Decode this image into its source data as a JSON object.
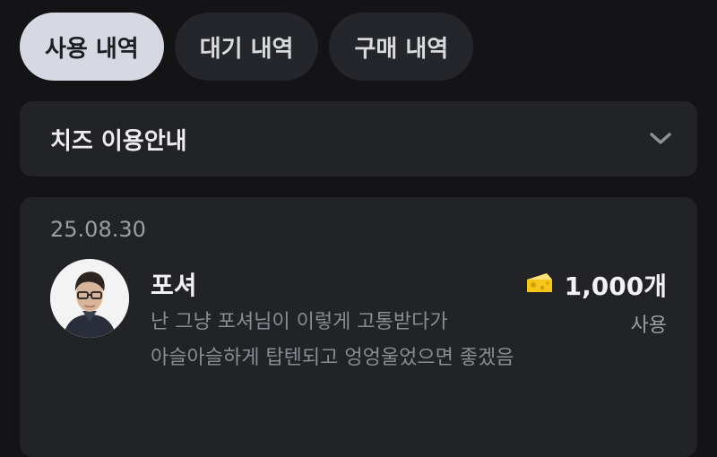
{
  "tabs": [
    {
      "label": "사용 내역",
      "active": true
    },
    {
      "label": "대기 내역",
      "active": false
    },
    {
      "label": "구매 내역",
      "active": false
    }
  ],
  "accordion": {
    "title": "치즈 이용안내",
    "icon": "chevron-down-icon"
  },
  "history": [
    {
      "date": "25.08.30",
      "name": "포셔",
      "message": "난 그냥 포셔님이 이렇게 고통받다가 아슬아슬하게 탑텐되고 엉엉울었으면 좋겠음",
      "amount": "1,000개",
      "amount_icon": "cheese-icon",
      "status": "사용"
    }
  ],
  "colors": {
    "background": "#141416",
    "card": "#222327",
    "active_tab": "#d6d9e2",
    "cheese": "#f5c518"
  }
}
